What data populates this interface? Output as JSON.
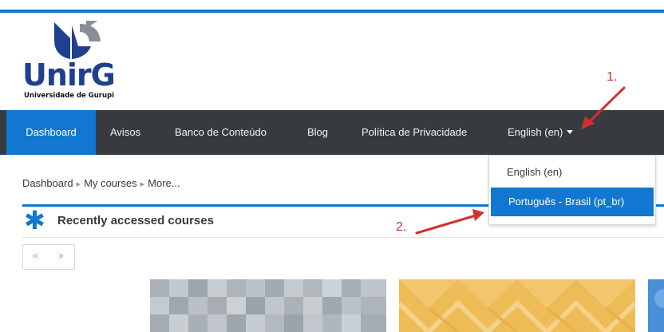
{
  "logo": {
    "name": "UnirG",
    "subtitle": "Universidade de Gurupi"
  },
  "nav": {
    "items": [
      {
        "label": "Dashboard"
      },
      {
        "label": "Avisos"
      },
      {
        "label": "Banco de Conteúdo"
      },
      {
        "label": "Blog"
      },
      {
        "label": "Política de Privacidade"
      }
    ],
    "language_label": "English (en)"
  },
  "language_menu": {
    "options": [
      {
        "label": "English (en)"
      },
      {
        "label": "Português - Brasil (pt_br)",
        "selected": true
      }
    ]
  },
  "breadcrumb": [
    "Dashboard",
    "My courses",
    "More..."
  ],
  "block": {
    "title": "Recently accessed courses",
    "prev_label": "«",
    "next_label": "»"
  },
  "annotations": {
    "step1": "1.",
    "step2": "2."
  },
  "colors": {
    "accent": "#1177d1",
    "navbar": "#373b3f",
    "annotation": "#d32f2f"
  }
}
